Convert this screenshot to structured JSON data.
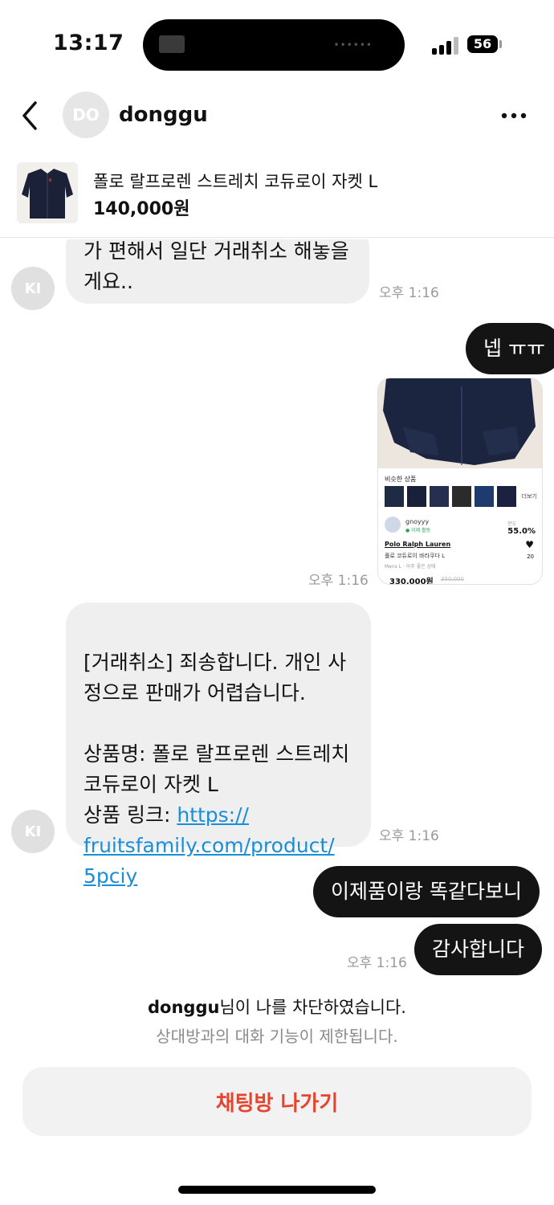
{
  "status_bar": {
    "time": "13:17",
    "battery": "56"
  },
  "header": {
    "avatar_initials": "DO",
    "username": "donggu"
  },
  "product": {
    "title": "폴로 랄프로렌 스트레치 코듀로이 자켓 L",
    "price": "140,000원"
  },
  "messages": {
    "m1": {
      "avatar": "KI",
      "text": "가 편해서 일단 거래취소 해놓을\n게요..",
      "time": "오후 1:16"
    },
    "m2": {
      "text": "넵 ㅠㅠ"
    },
    "card": {
      "similar_label": "비슷한 상품",
      "more_label": "더보기",
      "seller": "gnoyyy",
      "seller_status": "● 이제 활동",
      "score_label": "만도",
      "score": "55.0%",
      "brand": "Polo Ralph Lauren",
      "name": "폴로 코듀로이 바라쿠다 L",
      "condition": "Mens L · 아주 좋은 상태",
      "price": "330,000원",
      "old_price": "350,000",
      "likes": "20",
      "time": "오후 1:16"
    },
    "m3": {
      "avatar": "KI",
      "text": "[거래취소] 죄송합니다. 개인 사\n정으로 판매가 어렵습니다.\n\n상품명: 폴로 랄프로렌 스트레치\n코듀로이 자켓 L\n상품 링크: ",
      "link": "https://\nfruitsfamily.com/product/\n5pciy",
      "time": "오후 1:16"
    },
    "m4": {
      "text": "이제품이랑 똑같다보니"
    },
    "m5": {
      "text": "감사합니다",
      "time": "오후 1:16"
    }
  },
  "block_notice": {
    "name": "donggu",
    "line1_suffix": "님이 나를 차단하였습니다.",
    "line2": "상대방과의 대화 기능이 제한됩니다."
  },
  "leave_button": "채팅방 나가기",
  "colors": {
    "accent_red": "#e5452d",
    "link_blue": "#1a8ed8",
    "bubble_dark": "#141414",
    "bubble_light": "#efefef"
  }
}
